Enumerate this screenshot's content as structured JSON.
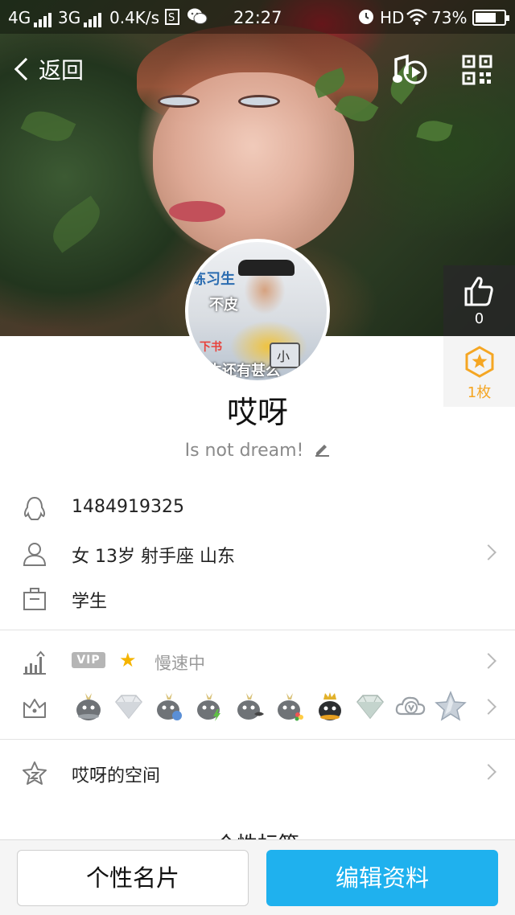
{
  "status_bar": {
    "network1": "4G",
    "network2": "3G",
    "speed": "0.4K/s",
    "time": "22:27",
    "hd": "HD",
    "battery": "73%",
    "battery_level": 0.73
  },
  "nav": {
    "back_label": "返回"
  },
  "side": {
    "like_count": "0",
    "coin_label": "1枚"
  },
  "avatar_text": {
    "sign1": "练习生",
    "sign2": "不皮",
    "sign3": "生还有甚么",
    "sign4": "下书",
    "cup": "小"
  },
  "profile": {
    "name": "哎呀",
    "signature": "Is not dream!",
    "qq": "1484919325",
    "info": "女  13岁  射手座  山东",
    "occupation": "学生"
  },
  "vip": {
    "badge": "VIP",
    "status": "慢速中"
  },
  "badges": [
    "penguin-badge",
    "diamond-badge",
    "penguin-badge",
    "penguin-badge",
    "penguin-badge",
    "penguin-badge",
    "crown-penguin-badge",
    "diamond-badge",
    "cloud-v-badge",
    "star-badge"
  ],
  "space": {
    "label": "哎呀的空间"
  },
  "tags": {
    "title": "· 个性标签 ·"
  },
  "buttons": {
    "card": "个性名片",
    "edit": "编辑资料"
  },
  "colors": {
    "accent": "#1fb1ee",
    "coin": "#f5a623"
  }
}
